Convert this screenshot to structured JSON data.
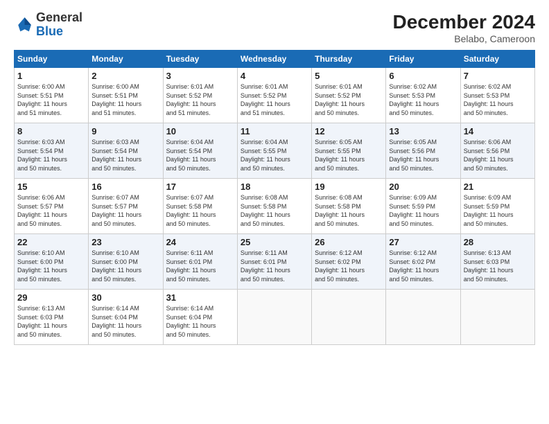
{
  "header": {
    "logo_general": "General",
    "logo_blue": "Blue",
    "month_year": "December 2024",
    "location": "Belabo, Cameroon"
  },
  "days_of_week": [
    "Sunday",
    "Monday",
    "Tuesday",
    "Wednesday",
    "Thursday",
    "Friday",
    "Saturday"
  ],
  "weeks": [
    [
      {
        "day": "1",
        "info": "Sunrise: 6:00 AM\nSunset: 5:51 PM\nDaylight: 11 hours\nand 51 minutes."
      },
      {
        "day": "2",
        "info": "Sunrise: 6:00 AM\nSunset: 5:51 PM\nDaylight: 11 hours\nand 51 minutes."
      },
      {
        "day": "3",
        "info": "Sunrise: 6:01 AM\nSunset: 5:52 PM\nDaylight: 11 hours\nand 51 minutes."
      },
      {
        "day": "4",
        "info": "Sunrise: 6:01 AM\nSunset: 5:52 PM\nDaylight: 11 hours\nand 51 minutes."
      },
      {
        "day": "5",
        "info": "Sunrise: 6:01 AM\nSunset: 5:52 PM\nDaylight: 11 hours\nand 50 minutes."
      },
      {
        "day": "6",
        "info": "Sunrise: 6:02 AM\nSunset: 5:53 PM\nDaylight: 11 hours\nand 50 minutes."
      },
      {
        "day": "7",
        "info": "Sunrise: 6:02 AM\nSunset: 5:53 PM\nDaylight: 11 hours\nand 50 minutes."
      }
    ],
    [
      {
        "day": "8",
        "info": "Sunrise: 6:03 AM\nSunset: 5:54 PM\nDaylight: 11 hours\nand 50 minutes."
      },
      {
        "day": "9",
        "info": "Sunrise: 6:03 AM\nSunset: 5:54 PM\nDaylight: 11 hours\nand 50 minutes."
      },
      {
        "day": "10",
        "info": "Sunrise: 6:04 AM\nSunset: 5:54 PM\nDaylight: 11 hours\nand 50 minutes."
      },
      {
        "day": "11",
        "info": "Sunrise: 6:04 AM\nSunset: 5:55 PM\nDaylight: 11 hours\nand 50 minutes."
      },
      {
        "day": "12",
        "info": "Sunrise: 6:05 AM\nSunset: 5:55 PM\nDaylight: 11 hours\nand 50 minutes."
      },
      {
        "day": "13",
        "info": "Sunrise: 6:05 AM\nSunset: 5:56 PM\nDaylight: 11 hours\nand 50 minutes."
      },
      {
        "day": "14",
        "info": "Sunrise: 6:06 AM\nSunset: 5:56 PM\nDaylight: 11 hours\nand 50 minutes."
      }
    ],
    [
      {
        "day": "15",
        "info": "Sunrise: 6:06 AM\nSunset: 5:57 PM\nDaylight: 11 hours\nand 50 minutes."
      },
      {
        "day": "16",
        "info": "Sunrise: 6:07 AM\nSunset: 5:57 PM\nDaylight: 11 hours\nand 50 minutes."
      },
      {
        "day": "17",
        "info": "Sunrise: 6:07 AM\nSunset: 5:58 PM\nDaylight: 11 hours\nand 50 minutes."
      },
      {
        "day": "18",
        "info": "Sunrise: 6:08 AM\nSunset: 5:58 PM\nDaylight: 11 hours\nand 50 minutes."
      },
      {
        "day": "19",
        "info": "Sunrise: 6:08 AM\nSunset: 5:58 PM\nDaylight: 11 hours\nand 50 minutes."
      },
      {
        "day": "20",
        "info": "Sunrise: 6:09 AM\nSunset: 5:59 PM\nDaylight: 11 hours\nand 50 minutes."
      },
      {
        "day": "21",
        "info": "Sunrise: 6:09 AM\nSunset: 5:59 PM\nDaylight: 11 hours\nand 50 minutes."
      }
    ],
    [
      {
        "day": "22",
        "info": "Sunrise: 6:10 AM\nSunset: 6:00 PM\nDaylight: 11 hours\nand 50 minutes."
      },
      {
        "day": "23",
        "info": "Sunrise: 6:10 AM\nSunset: 6:00 PM\nDaylight: 11 hours\nand 50 minutes."
      },
      {
        "day": "24",
        "info": "Sunrise: 6:11 AM\nSunset: 6:01 PM\nDaylight: 11 hours\nand 50 minutes."
      },
      {
        "day": "25",
        "info": "Sunrise: 6:11 AM\nSunset: 6:01 PM\nDaylight: 11 hours\nand 50 minutes."
      },
      {
        "day": "26",
        "info": "Sunrise: 6:12 AM\nSunset: 6:02 PM\nDaylight: 11 hours\nand 50 minutes."
      },
      {
        "day": "27",
        "info": "Sunrise: 6:12 AM\nSunset: 6:02 PM\nDaylight: 11 hours\nand 50 minutes."
      },
      {
        "day": "28",
        "info": "Sunrise: 6:13 AM\nSunset: 6:03 PM\nDaylight: 11 hours\nand 50 minutes."
      }
    ],
    [
      {
        "day": "29",
        "info": "Sunrise: 6:13 AM\nSunset: 6:03 PM\nDaylight: 11 hours\nand 50 minutes."
      },
      {
        "day": "30",
        "info": "Sunrise: 6:14 AM\nSunset: 6:04 PM\nDaylight: 11 hours\nand 50 minutes."
      },
      {
        "day": "31",
        "info": "Sunrise: 6:14 AM\nSunset: 6:04 PM\nDaylight: 11 hours\nand 50 minutes."
      },
      {
        "day": "",
        "info": ""
      },
      {
        "day": "",
        "info": ""
      },
      {
        "day": "",
        "info": ""
      },
      {
        "day": "",
        "info": ""
      }
    ]
  ]
}
